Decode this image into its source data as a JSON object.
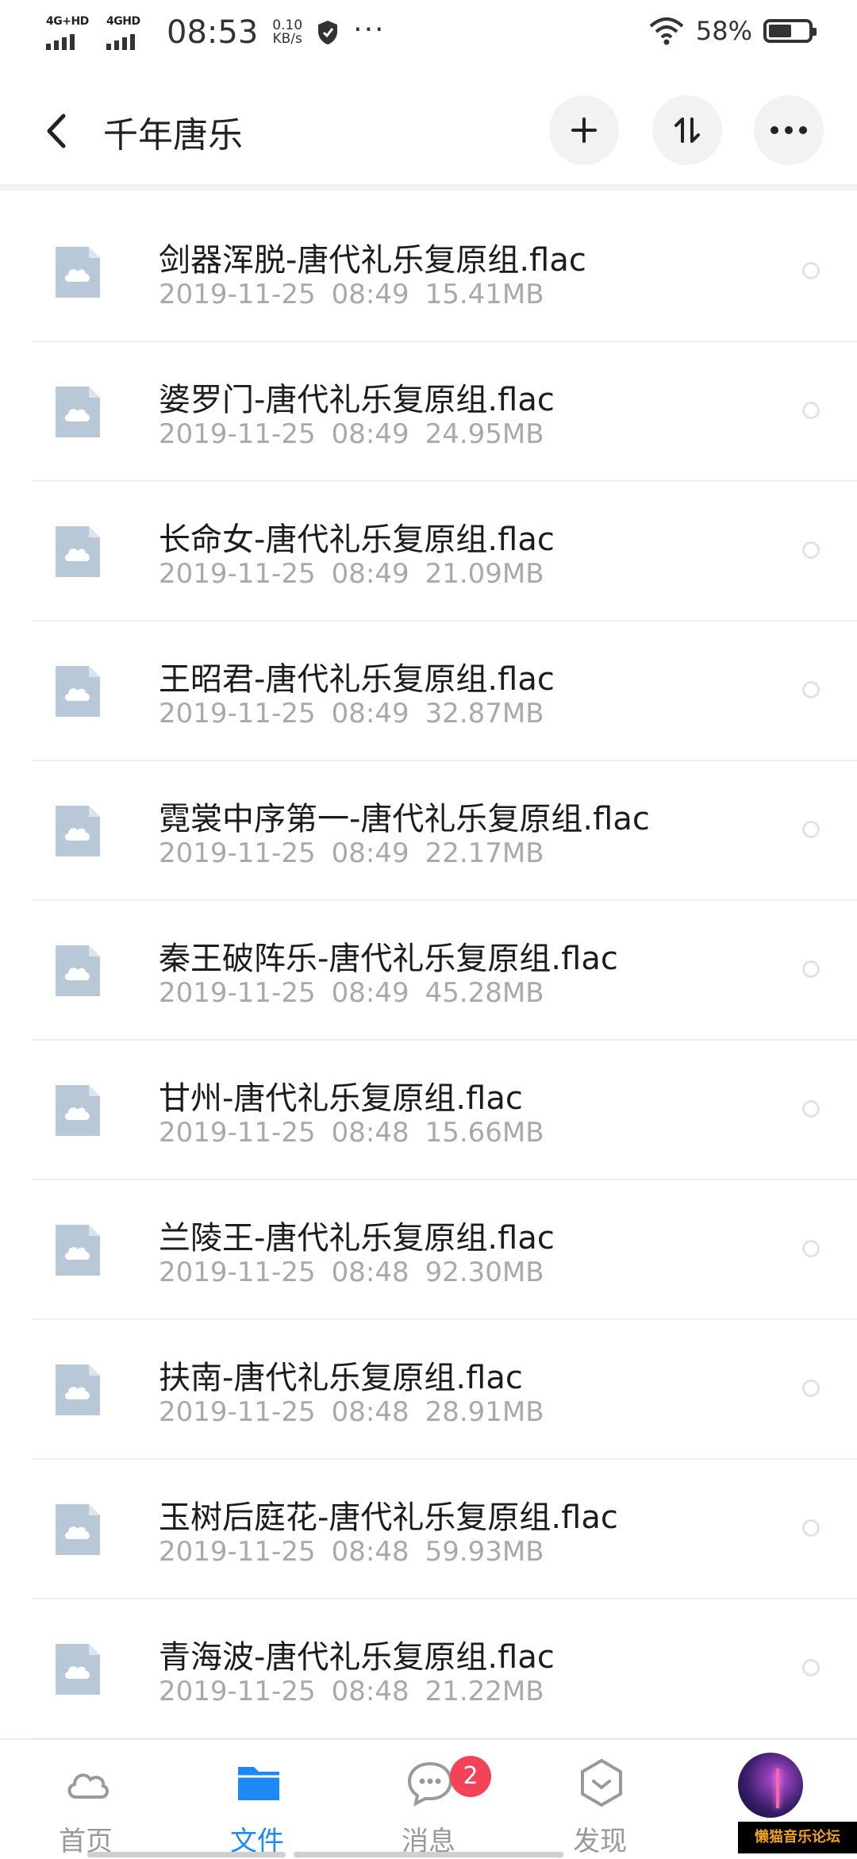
{
  "status_bar": {
    "net1": "4G+HD",
    "net2": "4GHD",
    "time": "08:53",
    "speed_value": "0.10",
    "speed_unit": "KB/s",
    "more": "···",
    "battery": "58%",
    "battery_level": 0.58
  },
  "header": {
    "title": "千年唐乐",
    "back_icon": "chevron-left-icon",
    "actions": [
      "plus-icon",
      "sort-icon",
      "more-icon"
    ]
  },
  "files": [
    {
      "name": "剑器浑脱-唐代礼乐复原组.flac",
      "date": "2019-11-25",
      "time": "08:49",
      "size": "15.41MB"
    },
    {
      "name": "婆罗门-唐代礼乐复原组.flac",
      "date": "2019-11-25",
      "time": "08:49",
      "size": "24.95MB"
    },
    {
      "name": "长命女-唐代礼乐复原组.flac",
      "date": "2019-11-25",
      "time": "08:49",
      "size": "21.09MB"
    },
    {
      "name": "王昭君-唐代礼乐复原组.flac",
      "date": "2019-11-25",
      "time": "08:49",
      "size": "32.87MB"
    },
    {
      "name": "霓裳中序第一-唐代礼乐复原组.flac",
      "date": "2019-11-25",
      "time": "08:49",
      "size": "22.17MB"
    },
    {
      "name": "秦王破阵乐-唐代礼乐复原组.flac",
      "date": "2019-11-25",
      "time": "08:49",
      "size": "45.28MB"
    },
    {
      "name": "甘州-唐代礼乐复原组.flac",
      "date": "2019-11-25",
      "time": "08:48",
      "size": "15.66MB"
    },
    {
      "name": "兰陵王-唐代礼乐复原组.flac",
      "date": "2019-11-25",
      "time": "08:48",
      "size": "92.30MB"
    },
    {
      "name": "扶南-唐代礼乐复原组.flac",
      "date": "2019-11-25",
      "time": "08:48",
      "size": "28.91MB"
    },
    {
      "name": "玉树后庭花-唐代礼乐复原组.flac",
      "date": "2019-11-25",
      "time": "08:48",
      "size": "59.93MB"
    },
    {
      "name": "青海波-唐代礼乐复原组.flac",
      "date": "2019-11-25",
      "time": "08:48",
      "size": "21.22MB"
    }
  ],
  "tabs": [
    {
      "label": "首页",
      "icon": "cloud-icon"
    },
    {
      "label": "文件",
      "icon": "folder-icon",
      "active": true
    },
    {
      "label": "消息",
      "icon": "message-icon",
      "badge": "2"
    },
    {
      "label": "发现",
      "icon": "discover-icon"
    }
  ],
  "watermark": "懒猫音乐论坛",
  "colors": {
    "accent": "#1e88f5",
    "badge": "#f24358",
    "file_icon": "#b9c8d6",
    "meta_text": "#a7a9ad"
  }
}
